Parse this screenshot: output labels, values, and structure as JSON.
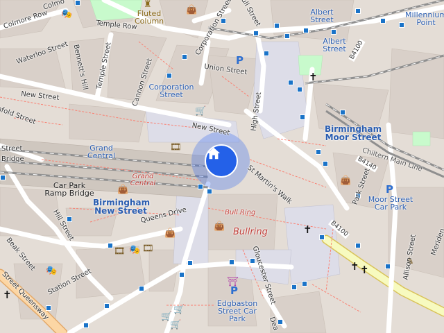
{
  "map": {
    "streets": [
      {
        "id": "colmore-row",
        "text": "Colmore Row"
      },
      {
        "id": "colmore",
        "text": "Colmo"
      },
      {
        "id": "temple-row",
        "text": "Temple Row"
      },
      {
        "id": "waterloo-street",
        "text": "Waterloo Street"
      },
      {
        "id": "bennetts-hill",
        "text": "Bennett's Hill"
      },
      {
        "id": "temple-street",
        "text": "Temple Street"
      },
      {
        "id": "cannon-street",
        "text": "Cannon Street"
      },
      {
        "id": "corporation-street-road",
        "text": "Corporation Street"
      },
      {
        "id": "bull-street",
        "text": "Bull Street"
      },
      {
        "id": "union-street",
        "text": "Union Street"
      },
      {
        "id": "new-street-west",
        "text": "New Street"
      },
      {
        "id": "new-street-east",
        "text": "New Street"
      },
      {
        "id": "high-street",
        "text": "High Street"
      },
      {
        "id": "stephenson-street",
        "text": "nfold Street"
      },
      {
        "id": "st-martins-walk",
        "text": "St Martin's Walk"
      },
      {
        "id": "queens-drive",
        "text": "Queens Drive"
      },
      {
        "id": "hill-street",
        "text": "Hill Street"
      },
      {
        "id": "beak-street",
        "text": "Beak Street"
      },
      {
        "id": "station-street",
        "text": "Station Street"
      },
      {
        "id": "street-queensway",
        "text": "Street Queensway"
      },
      {
        "id": "gloucester-street",
        "text": "Gloucester Street"
      },
      {
        "id": "park-street",
        "text": "Park Street"
      },
      {
        "id": "allison-street",
        "text": "Allison Street"
      },
      {
        "id": "meriden",
        "text": "Meriden"
      },
      {
        "id": "chiltern-main-line",
        "text": "Chiltern Main Line"
      },
      {
        "id": "dea",
        "text": "Dea"
      },
      {
        "id": "street-left",
        "text": "Street"
      },
      {
        "id": "bridge-left",
        "text": "Bridge"
      }
    ],
    "places": [
      {
        "id": "albert-street",
        "text": "Albert Street"
      },
      {
        "id": "albert-street-2",
        "text": "Albert Street"
      },
      {
        "id": "millennium-point",
        "text": "Millennium Point"
      },
      {
        "id": "corporation-street-stop",
        "text": "Corporation Street"
      },
      {
        "id": "grand-central-blue",
        "text": "Grand Central"
      },
      {
        "id": "car-park-ramp-bridge",
        "text": "Car Park Ramp Bridge"
      },
      {
        "id": "birmingham-new-street",
        "text": "Birmingham New Street"
      },
      {
        "id": "birmingham-moor-street",
        "text": "Birmingham Moor Street"
      },
      {
        "id": "moor-street-car-park",
        "text": "Moor Street Car Park"
      },
      {
        "id": "edgbaston-street-car-park",
        "text": "Edgbaston Street Car Park"
      }
    ],
    "shops": [
      {
        "id": "grand-central-red",
        "text": "Grand Central"
      },
      {
        "id": "bull-ring-red",
        "text": "Bull Ring"
      },
      {
        "id": "bullring-red",
        "text": "Bullring"
      }
    ],
    "landmarks": [
      {
        "id": "fluted-column",
        "text": "Fluted Column"
      }
    ],
    "road_refs": [
      {
        "id": "b4100",
        "text": "B4100"
      },
      {
        "id": "b4140",
        "text": "B4140"
      },
      {
        "id": "b4100-south",
        "text": "B4100"
      }
    ],
    "colors": {
      "background": "#e4ddd6",
      "building": "#d9d0c9",
      "pedestrian": "#dddde8",
      "primary_road": "#fcd6a4",
      "secondary_road": "#f7fabf",
      "rail": "#909090",
      "park": "#c8facc",
      "footway": "#fa8072",
      "bus_stop": "#1a73c8",
      "location": "#2461e8"
    }
  }
}
